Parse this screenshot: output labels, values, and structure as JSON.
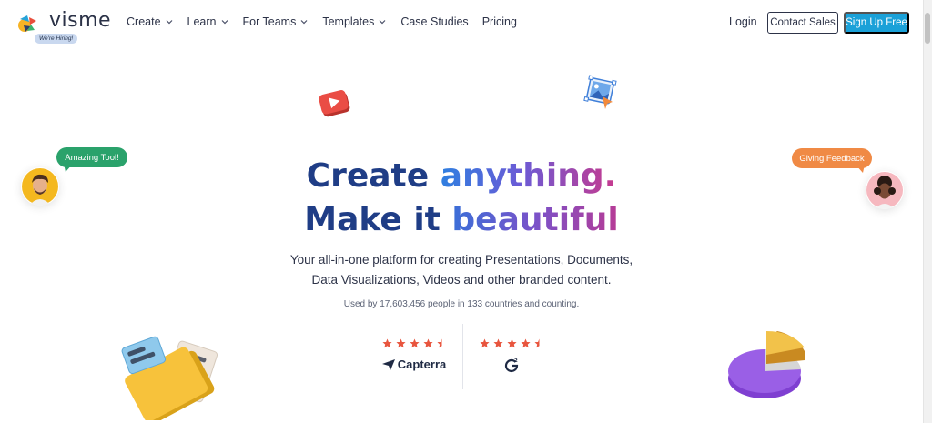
{
  "brand": {
    "name": "visme",
    "badge": "We're Hiring!"
  },
  "nav": {
    "items": [
      {
        "label": "Create",
        "dropdown": true
      },
      {
        "label": "Learn",
        "dropdown": true
      },
      {
        "label": "For Teams",
        "dropdown": true
      },
      {
        "label": "Templates",
        "dropdown": true
      },
      {
        "label": "Case Studies",
        "dropdown": false
      },
      {
        "label": "Pricing",
        "dropdown": false
      }
    ],
    "login": "Login",
    "contact_sales": "Contact Sales",
    "sign_up": "Sign Up Free"
  },
  "hero": {
    "line1_a": "Create ",
    "line1_b": "anything.",
    "line2_a": "Make it ",
    "line2_b": "beautiful",
    "subtitle_line1": "Your all-in-one platform for creating Presentations, Documents,",
    "subtitle_line2": "Data Visualizations, Videos and other branded content.",
    "stats": "Used by 17,603,456 people in 133 countries and counting."
  },
  "ratings": [
    {
      "brand": "Capterra",
      "stars": 4.5,
      "icon": "capterra-logo"
    },
    {
      "brand": "G2",
      "stars": 4.5,
      "icon": "g2-logo"
    }
  ],
  "bubbles": {
    "left": "Amazing Tool!",
    "right": "Giving Feedback"
  },
  "colors": {
    "accent": "#1ba1d8",
    "title_dark": "#1f3d86",
    "star": "#e8553e",
    "bubble_green": "#2aa26b",
    "bubble_orange": "#f08a45"
  }
}
